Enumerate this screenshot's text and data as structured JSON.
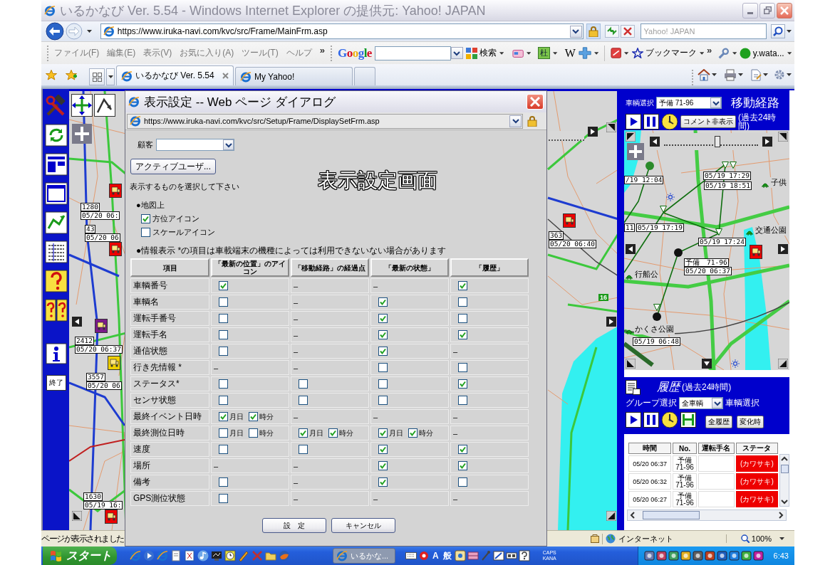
{
  "browser": {
    "title": "いるかなび Ver. 5.54 - Windows Internet Explorer の提供元: Yahoo! JAPAN",
    "url": "https://www.iruka-navi.com/kvc/src/Frame/MainFrm.asp",
    "search_placeholder": "Yahoo! JAPAN",
    "menu": [
      "ファイル(F)",
      "編集(E)",
      "表示(V)",
      "お気に入り(A)",
      "ツール(T)",
      "ヘルプ"
    ],
    "menu_overflow": "»",
    "toolbar": {
      "logo": "Google",
      "search_button": "検索",
      "dict_button": "杜",
      "wiki_button": "W",
      "bookmarks": "ブックマーク",
      "overflow": "»",
      "user": "y.wata..."
    },
    "tabs": [
      {
        "label": "いるかなび Ver. 5.54",
        "selected": true
      },
      {
        "label": "My Yahoo!",
        "selected": false
      }
    ]
  },
  "left_toolbar": {
    "exit_button": "終了"
  },
  "main_map": {
    "labels": [
      {
        "lines": [
          "1280",
          "05/20 06:"
        ]
      },
      {
        "lines": [
          "43",
          "05/20 06"
        ]
      },
      {
        "lines": [
          "2412",
          "05/20 06:37"
        ]
      },
      {
        "lines": [
          "3557",
          "05/20 06"
        ]
      },
      {
        "lines": [
          "1630",
          "05/19 16:"
        ]
      },
      {
        "lines": [
          "363",
          "05/20 06:40"
        ]
      }
    ],
    "markers": [
      {
        "color": "#ee0000"
      },
      {
        "color": "#ee0000"
      },
      {
        "color": "#7a1a8a"
      },
      {
        "color": "#f0d000"
      },
      {
        "color": "#ee0000"
      },
      {
        "color": "#ee0000"
      }
    ],
    "road_number": "16"
  },
  "dialog": {
    "title": "表示設定 -- Web ページ ダイアログ",
    "url": "https://www.iruka-navi.com/kvc/src/Setup/Frame/DisplaySetFrm.asp",
    "customer_label": "顧客",
    "active_user_button": "アクティブユーザ...",
    "heading": "表示設定画面",
    "instruction": "表示するものを選択して下さい",
    "map_section": {
      "title": "●地図上",
      "options": [
        {
          "label": "方位アイコン",
          "checked": true
        },
        {
          "label": "スケールアイコン",
          "checked": false
        }
      ]
    },
    "info_section": {
      "title": "●情報表示 *の項目は車載端末の機種によっては利用できないない場合があります"
    },
    "table": {
      "columns": [
        "項目",
        "「最新の位置」のアイコン",
        "「移動経路」の経過点",
        "「最新の状態」",
        "「履歴」"
      ],
      "rows": [
        {
          "cells": [
            {
              "kind": "text",
              "text": "車輌番号"
            },
            {
              "kind": "checkbox",
              "checked": true
            },
            {
              "kind": "text",
              "text": "–"
            },
            {
              "kind": "text",
              "text": "–"
            },
            {
              "kind": "checkbox",
              "checked": true
            }
          ]
        },
        {
          "cells": [
            {
              "kind": "text",
              "text": "車輌名"
            },
            {
              "kind": "checkbox",
              "checked": false
            },
            {
              "kind": "text",
              "text": "–"
            },
            {
              "kind": "checkbox",
              "checked": true
            },
            {
              "kind": "checkbox",
              "checked": false
            }
          ]
        },
        {
          "cells": [
            {
              "kind": "text",
              "text": "運転手番号"
            },
            {
              "kind": "checkbox",
              "checked": false
            },
            {
              "kind": "text",
              "text": "–"
            },
            {
              "kind": "checkbox",
              "checked": true
            },
            {
              "kind": "checkbox",
              "checked": false
            }
          ]
        },
        {
          "cells": [
            {
              "kind": "text",
              "text": "運転手名"
            },
            {
              "kind": "checkbox",
              "checked": false
            },
            {
              "kind": "text",
              "text": "–"
            },
            {
              "kind": "checkbox",
              "checked": true
            },
            {
              "kind": "checkbox",
              "checked": true
            }
          ]
        },
        {
          "cells": [
            {
              "kind": "text",
              "text": "通信状態"
            },
            {
              "kind": "checkbox",
              "checked": false
            },
            {
              "kind": "text",
              "text": "–"
            },
            {
              "kind": "checkbox",
              "checked": true
            },
            {
              "kind": "text",
              "text": "–"
            }
          ]
        },
        {
          "cells": [
            {
              "kind": "text",
              "text": "行き先情報 *"
            },
            {
              "kind": "text",
              "text": "–"
            },
            {
              "kind": "text",
              "text": "–"
            },
            {
              "kind": "checkbox",
              "checked": false
            },
            {
              "kind": "checkbox",
              "checked": false
            }
          ]
        },
        {
          "cells": [
            {
              "kind": "text",
              "text": "ステータス*"
            },
            {
              "kind": "checkbox",
              "checked": false
            },
            {
              "kind": "checkbox",
              "checked": false
            },
            {
              "kind": "checkbox",
              "checked": false
            },
            {
              "kind": "checkbox",
              "checked": true
            }
          ]
        },
        {
          "cells": [
            {
              "kind": "text",
              "text": "センサ状態"
            },
            {
              "kind": "checkbox",
              "checked": false
            },
            {
              "kind": "checkbox",
              "checked": false
            },
            {
              "kind": "checkbox",
              "checked": false
            },
            {
              "kind": "checkbox",
              "checked": false
            }
          ]
        },
        {
          "cells": [
            {
              "kind": "text",
              "text": "最終イベント日時"
            },
            {
              "kind": "pair",
              "options": [
                {
                  "label": "月日",
                  "checked": true
                },
                {
                  "label": "時分",
                  "checked": true
                }
              ]
            },
            {
              "kind": "text",
              "text": "–"
            },
            {
              "kind": "text",
              "text": "–"
            },
            {
              "kind": "text",
              "text": "–"
            }
          ]
        },
        {
          "cells": [
            {
              "kind": "text",
              "text": "最終測位日時"
            },
            {
              "kind": "pair",
              "options": [
                {
                  "label": "月日",
                  "checked": false
                },
                {
                  "label": "時分",
                  "checked": false
                }
              ]
            },
            {
              "kind": "pair",
              "options": [
                {
                  "label": "月日",
                  "checked": true
                },
                {
                  "label": "時分",
                  "checked": true
                }
              ]
            },
            {
              "kind": "pair",
              "options": [
                {
                  "label": "月日",
                  "checked": true
                },
                {
                  "label": "時分",
                  "checked": true
                }
              ]
            },
            {
              "kind": "text",
              "text": "–"
            }
          ]
        },
        {
          "cells": [
            {
              "kind": "text",
              "text": "速度"
            },
            {
              "kind": "checkbox",
              "checked": false
            },
            {
              "kind": "checkbox",
              "checked": false
            },
            {
              "kind": "checkbox",
              "checked": true
            },
            {
              "kind": "checkbox",
              "checked": true
            }
          ]
        },
        {
          "cells": [
            {
              "kind": "text",
              "text": "場所"
            },
            {
              "kind": "text",
              "text": "–"
            },
            {
              "kind": "text",
              "text": "–"
            },
            {
              "kind": "checkbox",
              "checked": true
            },
            {
              "kind": "checkbox",
              "checked": true
            }
          ]
        },
        {
          "cells": [
            {
              "kind": "text",
              "text": "備考"
            },
            {
              "kind": "checkbox",
              "checked": false
            },
            {
              "kind": "text",
              "text": "–"
            },
            {
              "kind": "checkbox",
              "checked": true
            },
            {
              "kind": "checkbox",
              "checked": false
            }
          ]
        },
        {
          "cells": [
            {
              "kind": "text",
              "text": "GPS測位状態"
            },
            {
              "kind": "checkbox",
              "checked": false
            },
            {
              "kind": "text",
              "text": "–"
            },
            {
              "kind": "text",
              "text": "–"
            },
            {
              "kind": "text",
              "text": "–"
            }
          ]
        }
      ]
    },
    "buttons": [
      "設　定",
      "キャンセル"
    ]
  },
  "route_panel": {
    "vehicle_label": "車輌選択",
    "vehicle": "予備 71-96",
    "title": "移動経路",
    "subtitle": "(過去24時間)",
    "comment_button": "コメント非表示",
    "slider": {
      "level": 0.57
    },
    "labels": [
      {
        "lines": [
          "/19 12:04"
        ]
      },
      {
        "lines": [
          "05/19 17:29"
        ]
      },
      {
        "lines": [
          "05/19 18:51"
        ]
      },
      {
        "lines": [
          "11"
        ]
      },
      {
        "lines": [
          "05/19 17:19"
        ]
      },
      {
        "lines": [
          "05/19 17:24"
        ]
      },
      {
        "lines": [
          "予備　71-96",
          "05/20 06:37"
        ]
      },
      {
        "lines": [
          "05/19 06:48"
        ]
      }
    ],
    "places": [
      "子供",
      "交通公園",
      "行船公",
      "かくさ公園"
    ],
    "marker": {
      "color": "#ee0000"
    }
  },
  "history_panel": {
    "title": "履歴",
    "subtitle": "(過去24時間)",
    "group_label": "グループ選択",
    "group": "全車輌",
    "vehicle_label": "車輌選択",
    "buttons": [
      "全履歴",
      "変化時"
    ],
    "table": {
      "columns": [
        "時間",
        "No.",
        "運転手名",
        "ステータ"
      ],
      "rows": [
        {
          "time": "05/20 06:37",
          "no": [
            "予備",
            "71-96"
          ],
          "status": "(カワサキ)"
        },
        {
          "time": "05/20 06:32",
          "no": [
            "予備",
            "71-96"
          ],
          "status": "(カワサキ)"
        },
        {
          "time": "05/20 06:27",
          "no": [
            "予備",
            "71-96"
          ],
          "status": "(カワサキ)"
        }
      ]
    }
  },
  "status_bar": {
    "text": "ページが表示されました",
    "zone": "インターネット",
    "zoom": "100%"
  },
  "taskbar": {
    "start": "スタート",
    "tasks": [
      {
        "label": "いるかな..."
      }
    ],
    "ime": [
      "A",
      "般"
    ],
    "indicators": [
      "CAPS",
      "KANA"
    ],
    "clock": "6:43"
  }
}
